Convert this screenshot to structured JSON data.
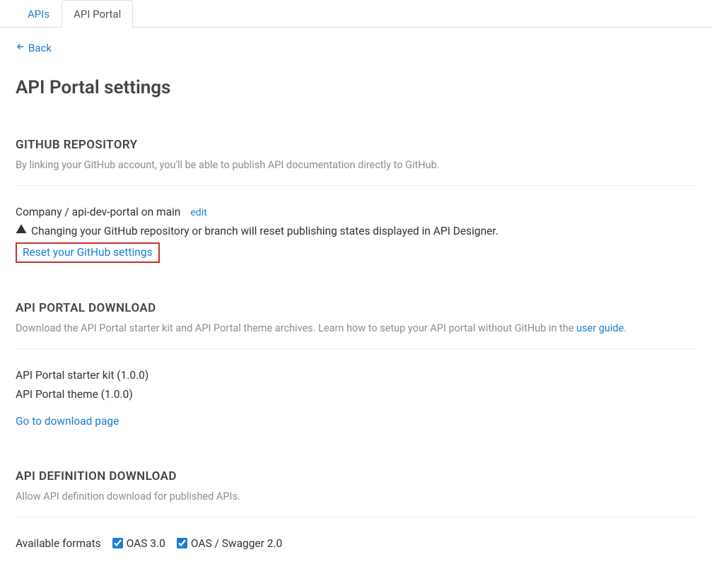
{
  "tabs": {
    "apis": "APIs",
    "api_portal": "API Portal"
  },
  "back": {
    "label": "Back"
  },
  "page_title": "API Portal settings",
  "github": {
    "heading": "GITHUB REPOSITORY",
    "description": "By linking your GitHub account, you'll be able to publish API documentation directly to GitHub.",
    "repo_line": "Company / api-dev-portal on main",
    "edit_label": "edit",
    "warning_text": "Changing your GitHub repository or branch will reset publishing states displayed in API Designer.",
    "reset_label": "Reset your GitHub settings"
  },
  "download": {
    "heading": "API PORTAL DOWNLOAD",
    "description_prefix": "Download the API Portal starter kit and API Portal theme archives. Learn how to setup your API portal without GitHub in the ",
    "description_link": "user guide",
    "description_suffix": ".",
    "starter_kit": "API Portal starter kit (1.0.0)",
    "theme": "API Portal theme (1.0.0)",
    "download_page_link": "Go to download page"
  },
  "api_def": {
    "heading": "API DEFINITION DOWNLOAD",
    "description": "Allow API definition download for published APIs.",
    "formats_label": "Available formats",
    "format_oas3": "OAS 3.0",
    "format_oas_swagger2": "OAS / Swagger 2.0"
  }
}
